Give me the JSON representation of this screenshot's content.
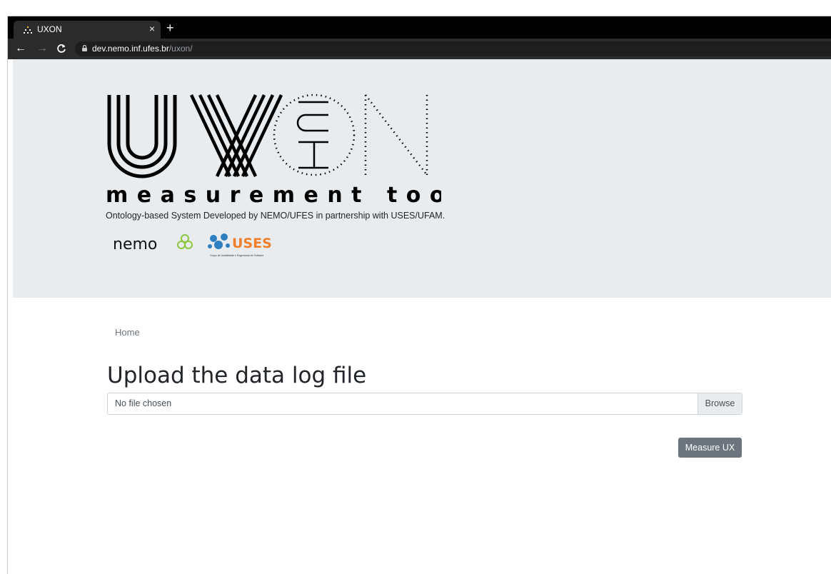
{
  "browser": {
    "tab_title": "UXON",
    "new_tab": "+",
    "tab_close": "×",
    "url_domain": "dev.nemo.inf.ufes.br",
    "url_path": "/uxon/"
  },
  "hero": {
    "logo_subtitle": "measurement tool",
    "logo_letters": [
      "HCI"
    ],
    "tagline": "Ontology-based System Developed by NEMO/UFES in partnership with USES/UFAM.",
    "partner_nemo": "nemo",
    "partner_uses": "USES",
    "partner_uses_caption": "Grupo de Usabilidade e Engenharia de Software"
  },
  "breadcrumb": "Home",
  "main": {
    "heading": "Upload the data log file",
    "file_placeholder": "No file chosen",
    "browse_label": "Browse",
    "submit_label": "Measure UX"
  }
}
